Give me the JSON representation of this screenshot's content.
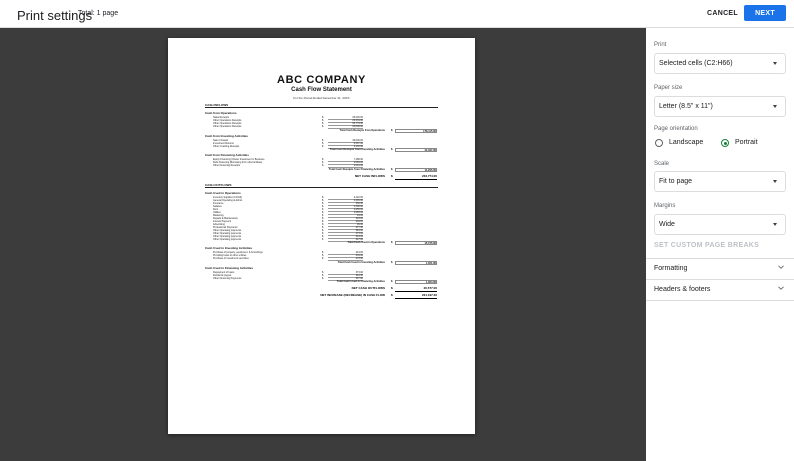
{
  "header": {
    "title": "Print settings",
    "total": "Total: 1 page",
    "cancel_label": "CANCEL",
    "next_label": "NEXT",
    "accent": "#1a73e8"
  },
  "preview": {
    "company": "ABC COMPANY",
    "statement": "Cash Flow Statement",
    "period": "For the Period Ended December 31, 20XX",
    "cash_inflows": "CASH INFLOWS",
    "operations_head": "Cash from Operations",
    "operations": [
      {
        "label": "Sales Receipts",
        "value": "25,000.00"
      },
      {
        "label": "Other Operations Receipts",
        "value": "25,334.00"
      },
      {
        "label": "Other Operations Receipts",
        "value": "65,779.00"
      },
      {
        "label": "Other Operations Receipts",
        "value": "65,808.00"
      }
    ],
    "operations_total_label": "Total Cash Receipts from Operations",
    "operations_total": "178,115.00",
    "investing_head": "Cash from Investing Activities",
    "investing": [
      {
        "label": "Sale of Assets",
        "value": "36,000.00"
      },
      {
        "label": "Investment Returns",
        "value": "6,367.00"
      },
      {
        "label": "Other Investing Receipts",
        "value": "2,130.00"
      }
    ],
    "investing_total_label": "Total Cash Receipts from Investing Activities",
    "investing_total": "44,497.00",
    "financing_head": "Cash from Financing Activities",
    "financing": [
      {
        "label": "Equity Financing (Owner Investment in Business",
        "value": "7,488.00"
      },
      {
        "label": "Debt Financing (Borrowing from other Entities)",
        "value": "2,566.00"
      },
      {
        "label": "Other Financing Receipts",
        "value": "1,241.00"
      }
    ],
    "financing_total_label": "Total Cash Receipts from Financing Activities",
    "financing_total": "11,295.00",
    "net_inflows_label": "NET CASH INFLOWS",
    "net_inflows": "233,774.00",
    "cash_outflows": "CASH OUTFLOWS",
    "used_ops_head": "Cash Used in Operations",
    "used_ops": [
      {
        "label": "Inventory Supplies (COGS)",
        "value": "2,422.00"
      },
      {
        "label": "General Operating & Admin",
        "value": "3,435.00"
      },
      {
        "label": "Insurance",
        "value": "350.00"
      },
      {
        "label": "Salaries",
        "value": "1,300.00"
      },
      {
        "label": "Rent",
        "value": "3,455.00"
      },
      {
        "label": "Utilities",
        "value": "1,595.00"
      },
      {
        "label": "Marketing",
        "value": "44.00"
      },
      {
        "label": "Repairs & Maintenance",
        "value": "323.00"
      },
      {
        "label": "Interest Payment",
        "value": "434.00"
      },
      {
        "label": "Advertising",
        "value": "99.00"
      },
      {
        "label": "Professional Payments",
        "value": "477.00"
      },
      {
        "label": "Other Operating payments",
        "value": "344.00"
      },
      {
        "label": "Other Operating payments",
        "value": "473.00"
      },
      {
        "label": "Other Operating payments",
        "value": "344.00"
      },
      {
        "label": "Other Operating payments",
        "value": "347.00"
      }
    ],
    "used_ops_total_label": "Total Cash Used in Operations",
    "used_ops_total": "15,725.00",
    "used_inv_head": "Cash Used in Investing Activities",
    "used_inv": [
      {
        "label": "Purchase of property, equipment, & furnishings",
        "value": "444.00"
      },
      {
        "label": "Providing loans to other entities",
        "value": "434.00"
      },
      {
        "label": "Purchase of investment securities",
        "value": "473.00"
      }
    ],
    "used_inv_total_label": "Total Cash Used in Investing Activities",
    "used_inv_total": "1,351.00",
    "used_fin_head": "Cash Used in Financing Activities",
    "used_fin": [
      {
        "label": "Repayment of loans",
        "value": "373.00"
      },
      {
        "label": "Dividends payout",
        "value": "344.00"
      },
      {
        "label": "Other Financing Payments",
        "value": "347.00"
      }
    ],
    "used_fin_total_label": "Total Cash Used in Financing Activities",
    "used_fin_total": "1,064.00",
    "net_outflows_label": "NET CASH OUTFLOWS",
    "net_outflows": "20,577.00",
    "net_change_label": "NET INCREASE (DECREASE) IN CASH FLOW",
    "net_change": "231,197.00",
    "dollar": "$"
  },
  "panel": {
    "print_label": "Print",
    "print_value": "Selected cells (C2:H66)",
    "paper_label": "Paper size",
    "paper_value": "Letter (8.5\" x 11\")",
    "orientation_label": "Page orientation",
    "landscape": "Landscape",
    "portrait": "Portrait",
    "orientation_selected": "Portrait",
    "scale_label": "Scale",
    "scale_value": "Fit to page",
    "margins_label": "Margins",
    "margins_value": "Wide",
    "breaks": "SET CUSTOM PAGE BREAKS",
    "formatting": "Formatting",
    "headers_footers": "Headers & footers",
    "radio_color": "#188038"
  }
}
